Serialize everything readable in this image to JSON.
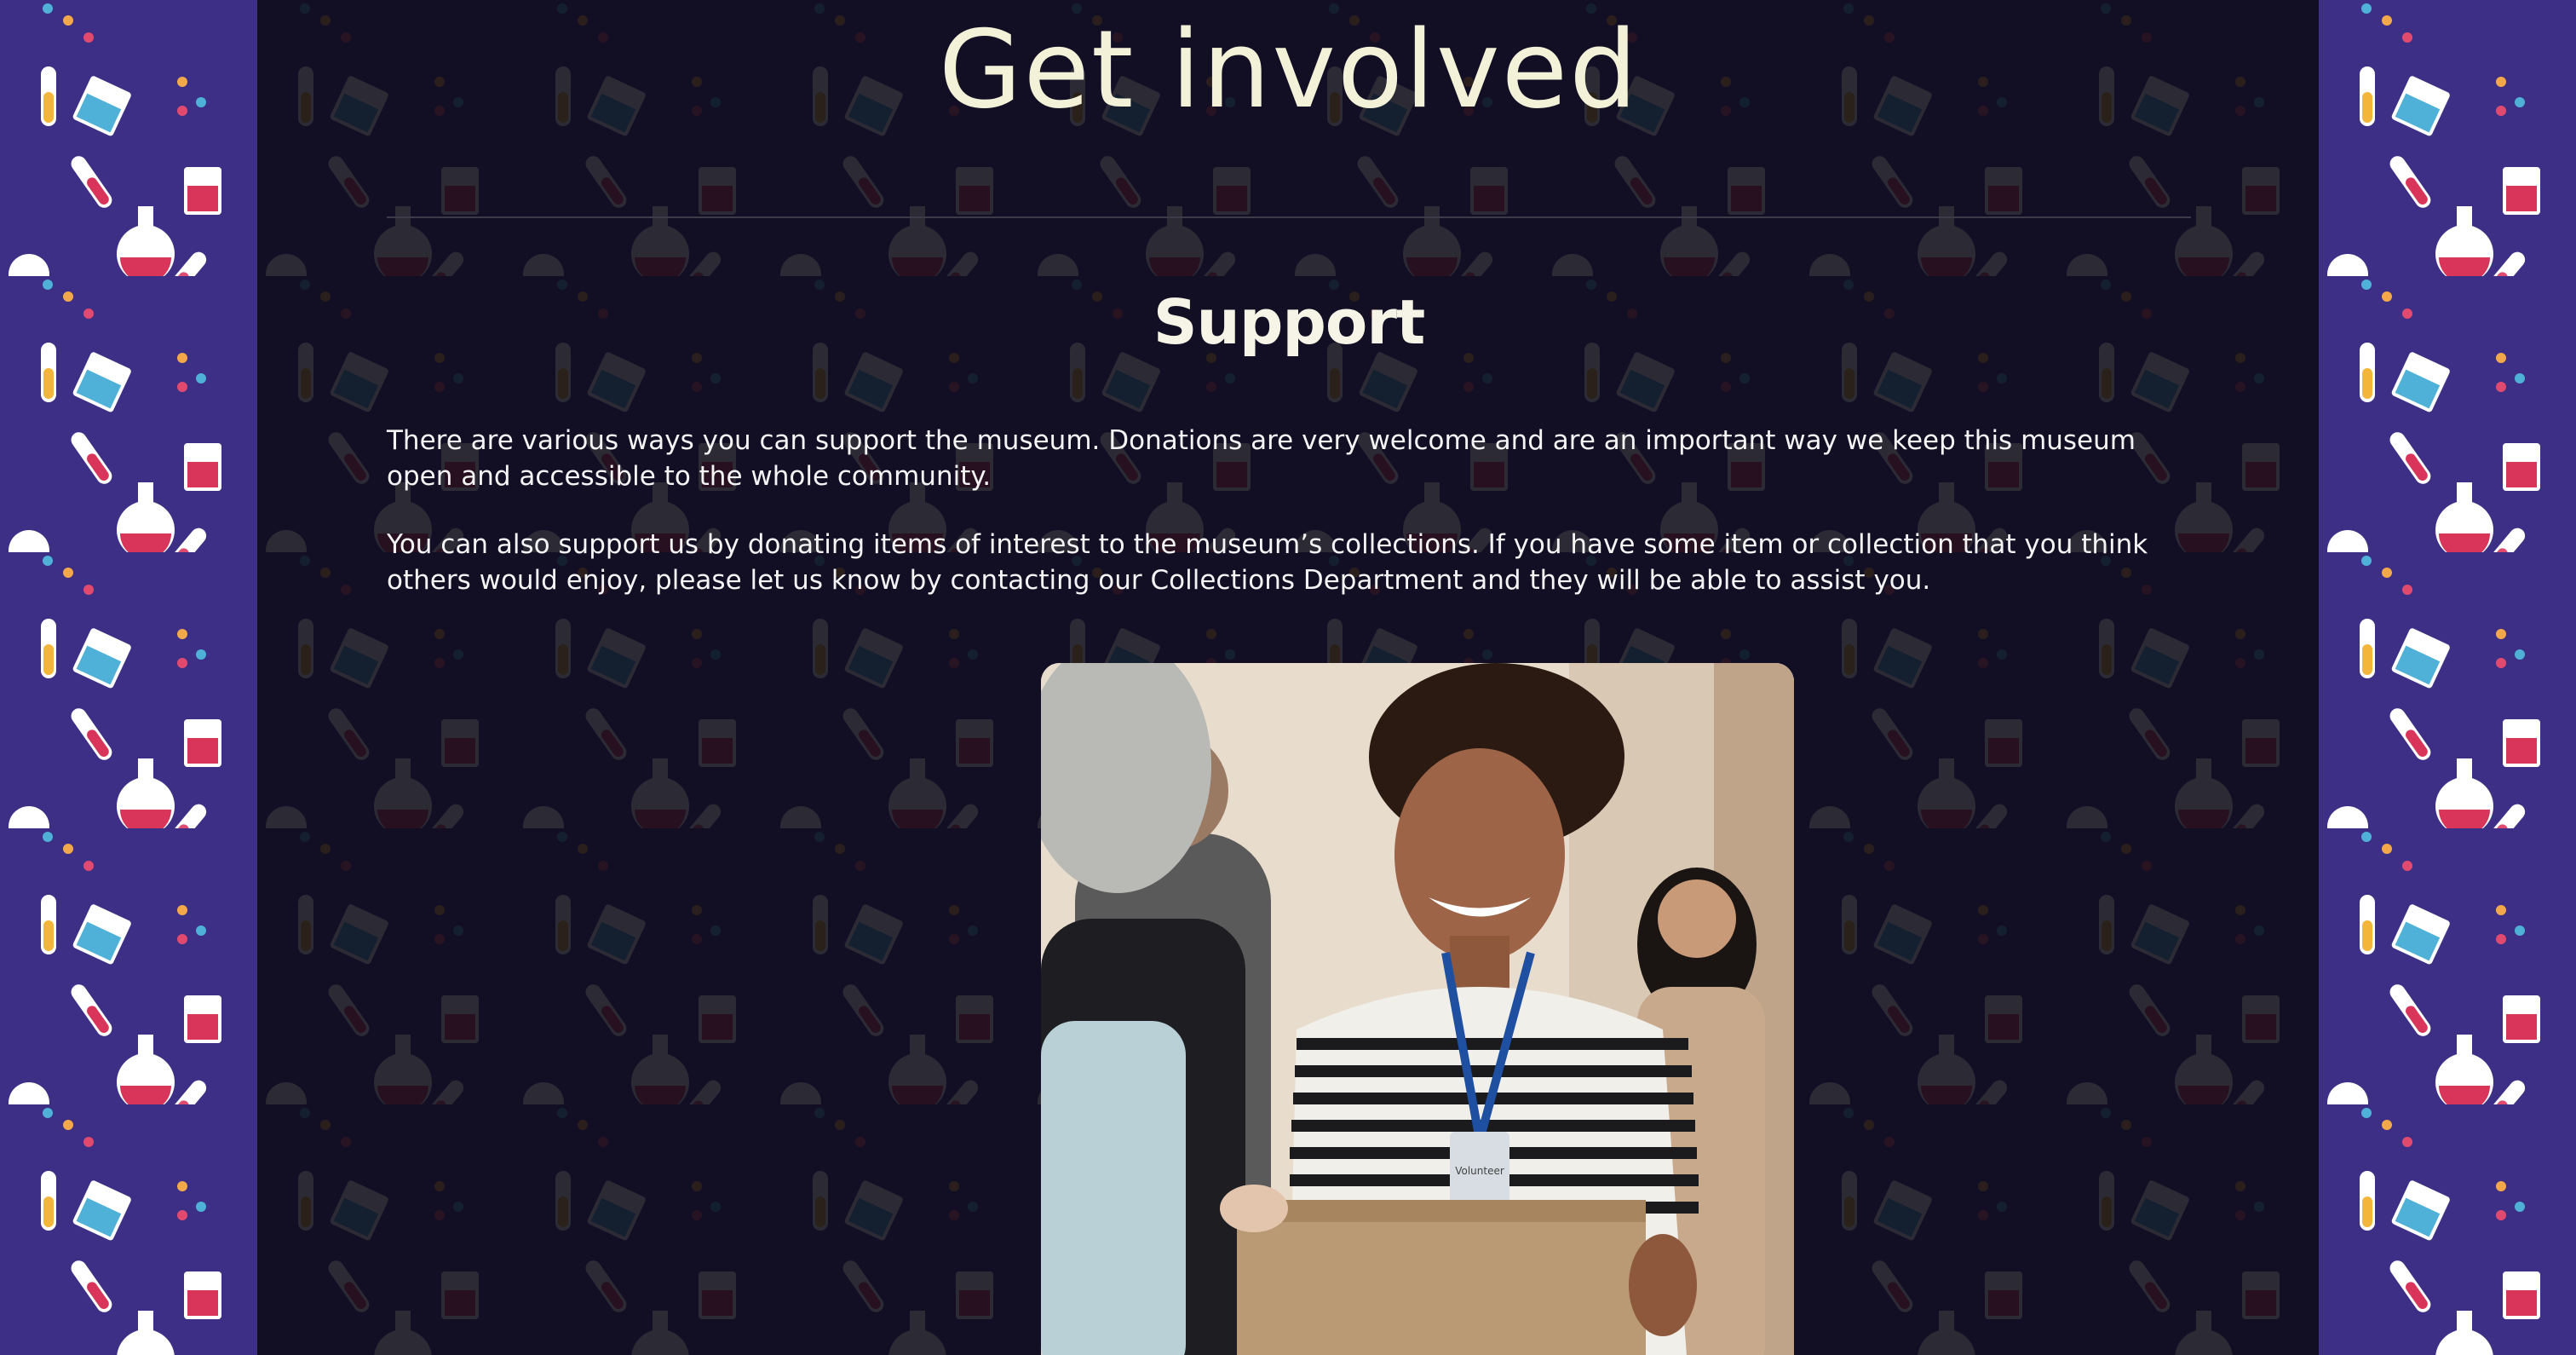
{
  "page": {
    "title": "Get involved"
  },
  "support": {
    "heading": "Support",
    "paragraph_1": "There are various ways you can support the museum. Donations are very welcome and are an important way we keep this museum open and accessible to the whole community.",
    "paragraph_2": "You can also support us by donating items of interest to the museum’s collections. If you have some item or collection that you think others would enjoy, please let us know by contacting our Collections Department and they will be able to assist you.",
    "photo_badge_text": "Volunteer"
  },
  "colors": {
    "side_background": "#3d2f86",
    "main_background": "#0c0b17",
    "title_text": "#f3f1d8",
    "body_text": "#f4f4f4"
  },
  "icons": [
    "test-tube-icon",
    "beaker-icon",
    "flask-icon",
    "molecule-dots-icon"
  ]
}
